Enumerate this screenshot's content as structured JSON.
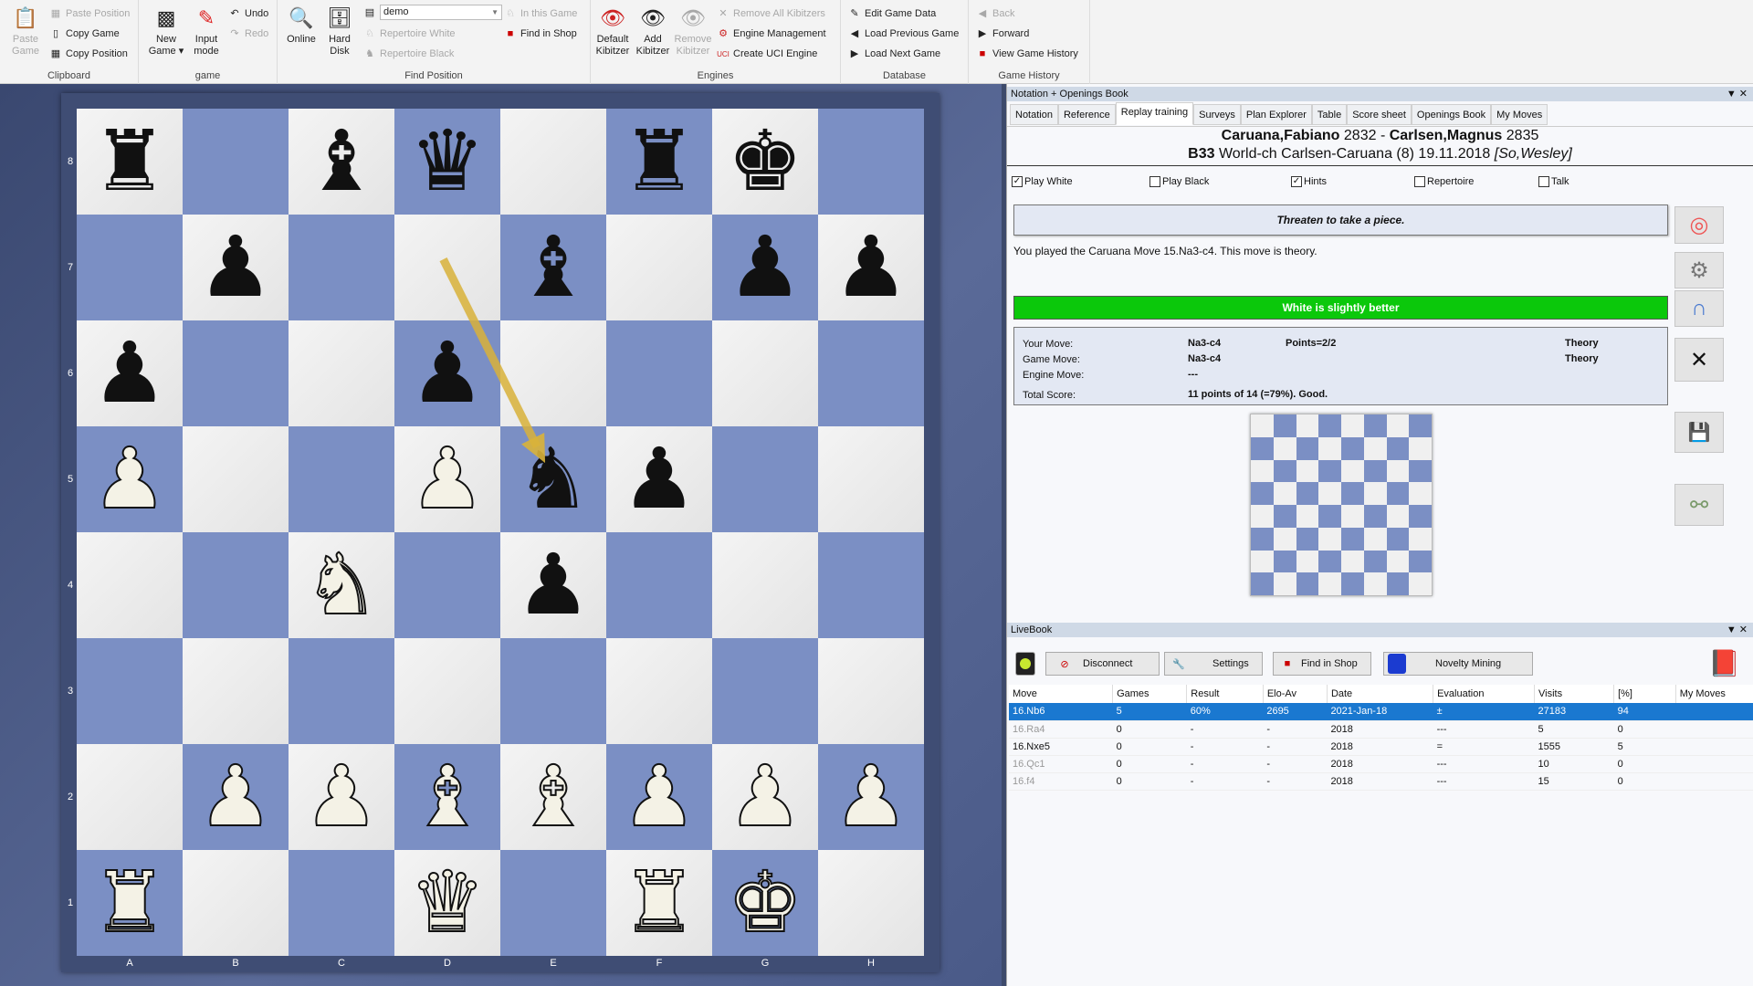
{
  "ribbon": {
    "clipboard": {
      "label": "Clipboard",
      "paste_game": "Paste Game",
      "paste_position": "Paste Position",
      "copy_game": "Copy Game",
      "copy_position": "Copy Position"
    },
    "game": {
      "label": "game",
      "new_game": "New Game",
      "input_mode": "Input mode",
      "undo": "Undo",
      "redo": "Redo"
    },
    "find": {
      "label": "Find Position",
      "online": "Online",
      "hard_disk": "Hard Disk",
      "db_value": "demo",
      "rep_white": "Repertoire White",
      "rep_black": "Repertoire Black",
      "in_game": "In this Game",
      "find_shop": "Find in Shop"
    },
    "engines": {
      "label": "Engines",
      "default_kib": "Default Kibitzer",
      "add_kib": "Add Kibitzer",
      "remove_kib": "Remove Kibitzer",
      "remove_all": "Remove All Kibitzers",
      "engine_mgmt": "Engine Management",
      "create_uci": "Create UCI Engine"
    },
    "database": {
      "label": "Database",
      "edit": "Edit Game Data",
      "prev": "Load Previous Game",
      "next": "Load Next Game"
    },
    "history": {
      "label": "Game History",
      "back": "Back",
      "forward": "Forward",
      "view": "View Game History"
    }
  },
  "board": {
    "ranks": [
      "8",
      "7",
      "6",
      "5",
      "4",
      "3",
      "2",
      "1"
    ],
    "files": [
      "A",
      "B",
      "C",
      "D",
      "E",
      "F",
      "G",
      "H"
    ],
    "position": [
      "r.bq.rk.",
      ".p..b.pp",
      "p..p....",
      "P..Pnp..",
      "..N.p...",
      "........",
      ".PPBBPPP",
      "R..Q.RK."
    ],
    "arrow": {
      "from": "d7",
      "to": "e5",
      "color": "#d9b23a"
    },
    "light_color": "#eeeeee",
    "dark_color": "#7b8fc4"
  },
  "notation": {
    "title": "Notation + Openings Book",
    "tabs": [
      "Notation",
      "Reference",
      "Replay training",
      "Surveys",
      "Plan Explorer",
      "Table",
      "Score sheet",
      "Openings Book",
      "My Moves"
    ],
    "active_tab": "Replay training",
    "white": "Caruana,Fabiano",
    "white_elo": "2832",
    "sep": " - ",
    "black": "Carlsen,Magnus",
    "black_elo": "2835",
    "eco": "B33",
    "event": "World-ch Carlsen-Caruana (8) 19.11.2018",
    "annotator": "[So,Wesley]",
    "options": [
      {
        "label": "Play White",
        "checked": true
      },
      {
        "label": "Play Black",
        "checked": false
      },
      {
        "label": "Hints",
        "checked": true
      },
      {
        "label": "Repertoire",
        "checked": false
      },
      {
        "label": "Talk",
        "checked": false
      }
    ],
    "hint": "Threaten to take a piece.",
    "message": "You played the Caruana Move 15.Na3-c4. This move is theory.",
    "eval_bar": "White is slightly better",
    "eval_color": "#0bc80b",
    "score": {
      "your_move_label": "Your Move:",
      "your_move": "Na3-c4",
      "points": "Points=2/2",
      "your_status": "Theory",
      "game_move_label": "Game Move:",
      "game_move": "Na3-c4",
      "game_status": "Theory",
      "engine_move_label": "Engine Move:",
      "engine_move": "---",
      "total_label": "Total Score:",
      "total": "11 points of 14 (=79%). Good."
    },
    "side_icons": [
      "lifebuoy-icon",
      "gears-icon",
      "magnet-icon",
      "satellite-dish-icon",
      "save-icon",
      "glasses-icon"
    ]
  },
  "livebook": {
    "title": "LiveBook",
    "disconnect": "Disconnect",
    "settings": "Settings",
    "find_shop": "Find in Shop",
    "novelty": "Novelty Mining",
    "columns": [
      "Move",
      "Games",
      "Result",
      "Elo-Av",
      "Date",
      "Evaluation",
      "Visits",
      "[%]",
      "My Moves"
    ],
    "rows": [
      [
        "16.Nb6",
        "5",
        "60%",
        "2695",
        "2021-Jan-18",
        "±",
        "27183",
        "94",
        ""
      ],
      [
        "16.Ra4",
        "0",
        "-",
        "-",
        "2018",
        "---",
        "5",
        "0",
        ""
      ],
      [
        "16.Nxe5",
        "0",
        "-",
        "-",
        "2018",
        "=",
        "1555",
        "5",
        ""
      ],
      [
        "16.Qc1",
        "0",
        "-",
        "-",
        "2018",
        "---",
        "10",
        "0",
        ""
      ],
      [
        "16.f4",
        "0",
        "-",
        "-",
        "2018",
        "---",
        "15",
        "0",
        ""
      ]
    ]
  }
}
